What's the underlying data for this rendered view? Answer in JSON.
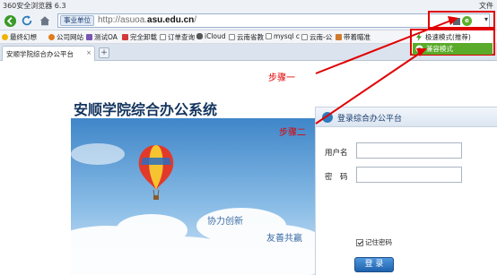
{
  "window": {
    "title": "360安全浏览器 6.3",
    "file_menu": "文件"
  },
  "nav": {
    "mode_tag": "事业单位",
    "url_prefix": "http://asuoa.",
    "url_domain": "asu.edu.cn",
    "url_suffix": "/",
    "mode_indicator": "e",
    "dropdown_glyph": "▾"
  },
  "bookmarks": [
    {
      "label": "最终幻想",
      "icon": "star-icon",
      "color": "#f0b400"
    },
    {
      "label": "公司网站",
      "icon": "globe-icon",
      "color": "#e27b1a"
    },
    {
      "label": "测试OA",
      "icon": "page-icon",
      "color": "#7a55b5"
    },
    {
      "label": "完全卸载",
      "icon": "page-icon",
      "color": "#d23a3a"
    },
    {
      "label": "订单查询",
      "icon": "page-icon",
      "color": "#8a8a8a"
    },
    {
      "label": "iCloud",
      "icon": "apple-icon",
      "color": "#555555"
    },
    {
      "label": "云南省教",
      "icon": "page-icon",
      "color": "#8a8a8a"
    },
    {
      "label": "mysql c",
      "icon": "page-icon",
      "color": "#8a8a8a"
    },
    {
      "label": "云南-公",
      "icon": "page-icon",
      "color": "#8a8a8a"
    },
    {
      "label": "带着瞄准",
      "icon": "page-icon",
      "color": "#d27a2a"
    }
  ],
  "tab": {
    "label": "安顺学院综合办公平台",
    "close": "×",
    "new_tab": "+"
  },
  "mode_menu": {
    "items": [
      {
        "label": "极速模式(推荐)",
        "icon": "bolt-icon"
      },
      {
        "label": "兼容模式",
        "icon": "ie-icon"
      }
    ]
  },
  "page": {
    "title": "安顺学院综合办公系统",
    "slogan_1": "协力创新",
    "slogan_2": "友善共赢",
    "login": {
      "header": "登录综合办公平台",
      "username_label": "用户名",
      "password_label": "密　码",
      "remember_label": "记住密码",
      "submit": "登 录"
    }
  },
  "annotations": {
    "step1": "步骤一",
    "step2": "步骤二"
  },
  "colors": {
    "accent_red": "#e00000",
    "compat_green": "#5aab2a",
    "title_blue": "#13345e"
  }
}
